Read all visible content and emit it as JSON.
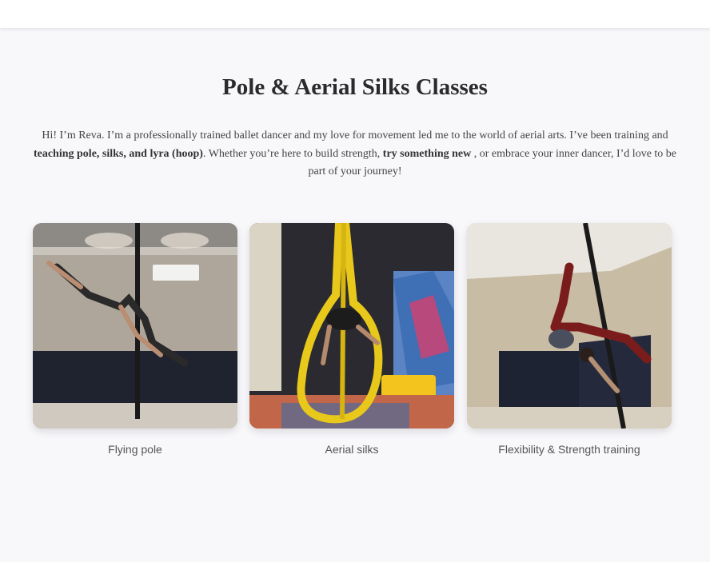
{
  "header": {},
  "section": {
    "title": "Pole & Aerial Silks Classes",
    "intro": {
      "p1": "Hi! I’m Reva. I’m a professionally trained ballet dancer and my love for movement led me to the world of aerial arts. I’ve been training and ",
      "b1": "teaching pole, silks, and lyra (hoop)",
      "p2": ". Whether you’re here to build strength, ",
      "b2": "try something new",
      "p3": " , or embrace your inner dancer, I’d love to be part of your journey!"
    },
    "cards": [
      {
        "caption": "Flying pole",
        "photo": "flying-pole-photo"
      },
      {
        "caption": "Aerial silks",
        "photo": "aerial-silks-photo"
      },
      {
        "caption": "Flexibility & Strength training",
        "photo": "flexibility-strength-photo"
      }
    ]
  },
  "colors": {
    "page_background": "#f8f8fb",
    "header_background": "#ffffff",
    "title": "#2b2b2b",
    "text": "#444444",
    "caption": "#555555"
  }
}
